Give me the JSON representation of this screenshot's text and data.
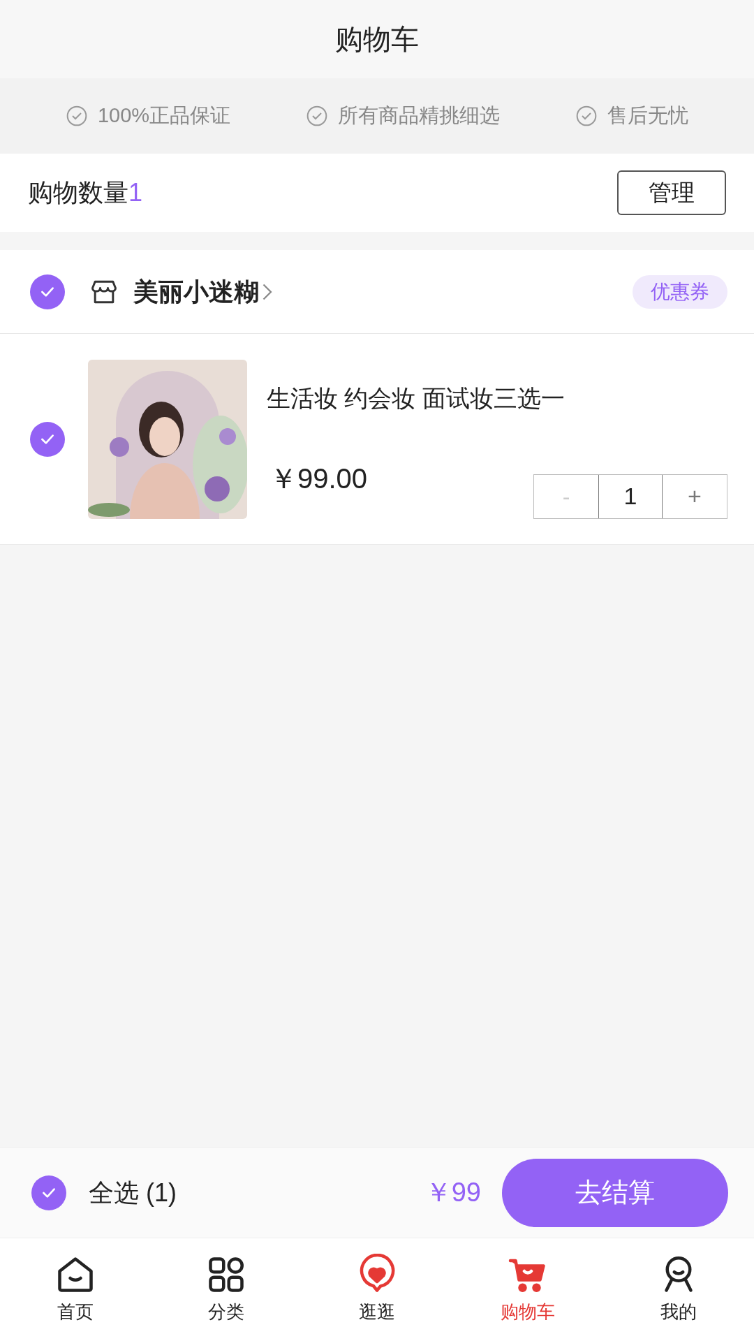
{
  "header": {
    "title": "购物车"
  },
  "guarantees": [
    "100%正品保证",
    "所有商品精挑细选",
    "售后无忧"
  ],
  "summary": {
    "label": "购物数量",
    "count": "1",
    "manage": "管理"
  },
  "store": {
    "name": "美丽小迷糊",
    "checked": true,
    "coupon": "优惠券"
  },
  "items": [
    {
      "title": "生活妆 约会妆 面试妆三选一",
      "price": "￥99.00",
      "checked": true,
      "minus": "-",
      "quantity": "1",
      "plus": "+",
      "minus_disabled": true
    }
  ],
  "footer": {
    "select_all": "全选 (1)",
    "checked": true,
    "total": "￥99",
    "checkout": "去结算"
  },
  "tabs": [
    {
      "label": "首页",
      "kind": "home",
      "selected": false
    },
    {
      "label": "分类",
      "kind": "grid",
      "selected": false
    },
    {
      "label": "逛逛",
      "kind": "heart",
      "selected": false
    },
    {
      "label": "购物车",
      "kind": "cart",
      "selected": true
    },
    {
      "label": "我的",
      "kind": "user",
      "selected": false
    }
  ]
}
